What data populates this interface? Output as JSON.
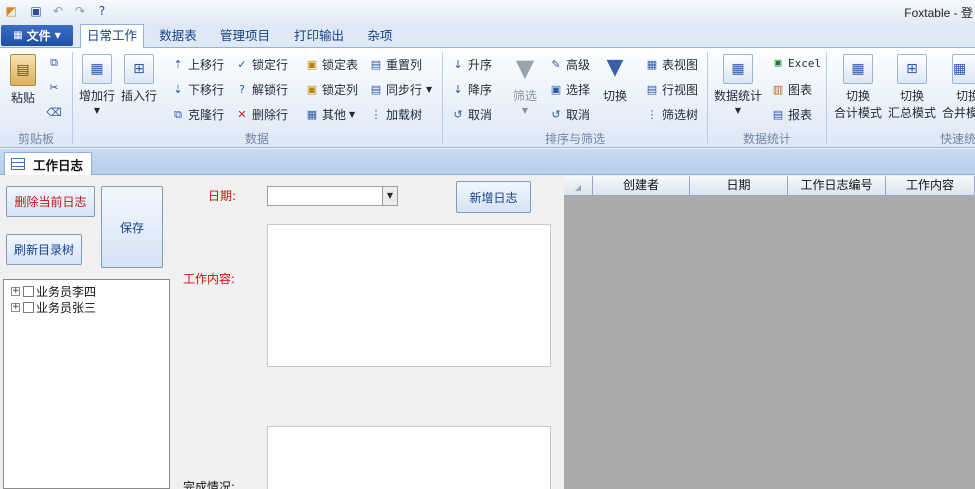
{
  "app": {
    "title": "Foxtable - 登"
  },
  "quick_access": [
    {
      "icon": "app-logo-icon"
    },
    {
      "icon": "save-icon"
    },
    {
      "icon": "undo-icon"
    },
    {
      "icon": "redo-icon"
    },
    {
      "icon": "help-icon"
    }
  ],
  "ribbon_tabs": {
    "file": "文件",
    "tabs": [
      "日常工作",
      "数据表",
      "管理项目",
      "打印输出",
      "杂项"
    ],
    "active": "日常工作"
  },
  "ribbon": {
    "clipboard": {
      "label": "剪贴板",
      "paste": "粘贴"
    },
    "data": {
      "label": "数据",
      "add_row": "增加行",
      "insert_row": "插入行",
      "move_up": "上移行",
      "move_down": "下移行",
      "clone_row": "克隆行",
      "lock_row": "锁定行",
      "unlock_row": "解锁行",
      "delete_row": "删除行",
      "lock_table": "锁定表",
      "lock_col": "锁定列",
      "other": "其他",
      "reset_col": "重置列",
      "sync_row": "同步行",
      "load_tree": "加载树"
    },
    "sort_filter": {
      "label": "排序与筛选",
      "asc": "升序",
      "desc": "降序",
      "cancel_sort": "取消",
      "filter": "筛选",
      "advanced": "高级",
      "select": "选择",
      "cancel_filter": "取消",
      "toggle": "切换",
      "table_view": "表视图",
      "row_view": "行视图",
      "filter_tree": "筛选树"
    },
    "stats": {
      "label": "数据统计",
      "data_stats": "数据统计",
      "excel": "Excel",
      "chart": "图表",
      "report": "报表"
    },
    "quick": {
      "label": "快速统",
      "mode1_a": "切换",
      "mode1_b": "合计模式",
      "mode2_a": "切换",
      "mode2_b": "汇总模式",
      "mode3_a": "切换",
      "mode3_b": "合并模"
    }
  },
  "doc_tab": {
    "label": "工作日志"
  },
  "form": {
    "delete_btn": "删除当前日志",
    "refresh_btn": "刷新目录树",
    "save_btn": "保存",
    "new_btn": "新增日志",
    "date_label": "日期:",
    "content_label": "工作内容:",
    "status_label": "完成情况:",
    "date_value": ""
  },
  "tree": {
    "nodes": [
      "业务员李四",
      "业务员张三"
    ]
  },
  "grid": {
    "columns": [
      "创建者",
      "日期",
      "工作日志编号",
      "工作内容"
    ]
  },
  "colors": {
    "ribbon_accent": "#15428b",
    "label_red": "#cc1111",
    "grid_bg": "#aaaaaa"
  }
}
